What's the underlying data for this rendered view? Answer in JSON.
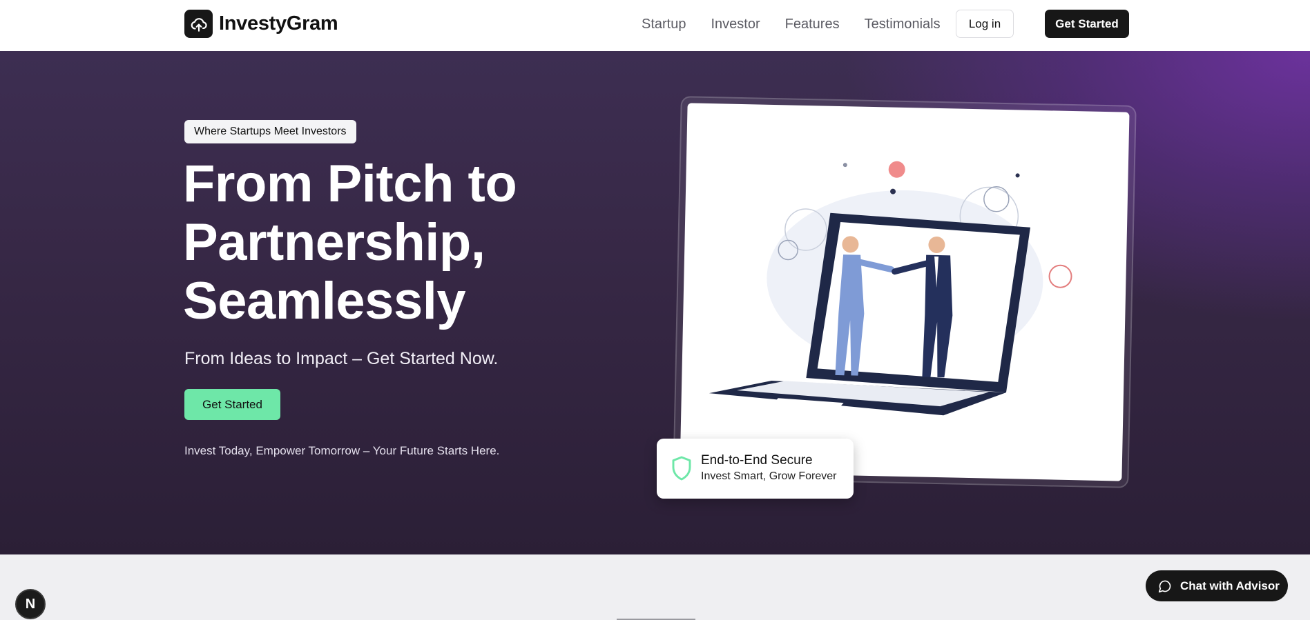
{
  "header": {
    "brand": "InvestyGram",
    "nav": [
      "Startup",
      "Investor",
      "Features",
      "Testimonials"
    ],
    "login_label": "Log in",
    "get_started_label": "Get Started"
  },
  "hero": {
    "tag": "Where Startups Meet Investors",
    "headline_lines": [
      "From Pitch to",
      "Partnership,",
      "Seamlessly"
    ],
    "subhead": "From Ideas to Impact – Get Started Now.",
    "cta_label": "Get Started",
    "tagline": "Invest Today, Empower Tomorrow – Your Future Starts Here.",
    "secure_card": {
      "title": "End-to-End Secure",
      "subtitle": "Invest Smart, Grow Forever"
    }
  },
  "dev_badge": "N",
  "chat": {
    "label": "Chat with Advisor"
  },
  "colors": {
    "accent_green": "#6ee7a8",
    "dark": "#171717",
    "hero_purple": "#3d2e52"
  }
}
